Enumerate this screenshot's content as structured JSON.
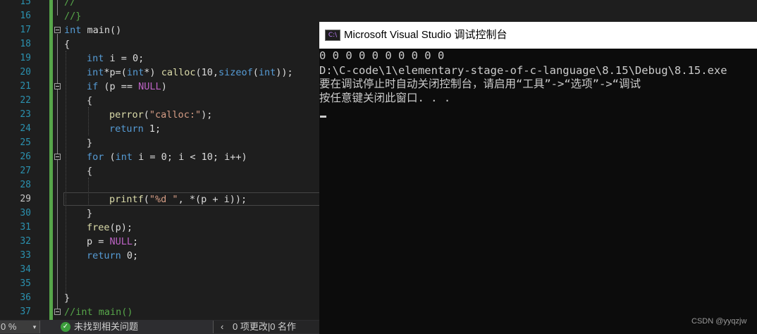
{
  "editor": {
    "line_numbers": [
      "15",
      "16",
      "17",
      "18",
      "19",
      "20",
      "21",
      "22",
      "23",
      "24",
      "25",
      "26",
      "27",
      "28",
      "29",
      "30",
      "31",
      "32",
      "33",
      "34",
      "35",
      "36",
      "37"
    ],
    "code": {
      "l15": "//",
      "l16": "//}",
      "l17_kw": "int",
      "l17_rest": " main()",
      "l18": "{",
      "l19_kw": "int",
      "l19_rest": " i = 0;",
      "l20_kw1": "int",
      "l20_a": "*p=(",
      "l20_kw2": "int",
      "l20_b": "*) ",
      "l20_fn": "calloc",
      "l20_c": "(10,",
      "l20_kw3": "sizeof",
      "l20_d": "(",
      "l20_kw4": "int",
      "l20_e": "));",
      "l21_kw": "if",
      "l21_a": " (p == ",
      "l21_mac": "NULL",
      "l21_b": ")",
      "l22": "{",
      "l23_fn": "perror",
      "l23_a": "(",
      "l23_str": "\"calloc:\"",
      "l23_b": ");",
      "l24_kw": "return",
      "l24_rest": " 1;",
      "l25": "}",
      "l26_kw": "for",
      "l26_a": " (",
      "l26_kw2": "int",
      "l26_b": " i = 0; i < 10; i++)",
      "l27": "{",
      "l29_fn": "printf",
      "l29_a": "(",
      "l29_str": "\"%d \"",
      "l29_b": ", *(p + i));",
      "l30": "}",
      "l31_fn": "free",
      "l31_rest": "(p);",
      "l32_a": "p = ",
      "l32_mac": "NULL",
      "l32_b": ";",
      "l33_kw": "return",
      "l33_rest": " 0;",
      "l36": "}",
      "l37": "//int main()"
    }
  },
  "statusbar": {
    "zoom": "0 %",
    "zoom_arrow": "▾",
    "issues_icon": "check-circle-icon",
    "issues_text": "未找到相关问题",
    "changes_arrow": "‹",
    "changes_text": "0 项更改|0 名作"
  },
  "console": {
    "icon_label": "C:\\",
    "title": "Microsoft Visual Studio 调试控制台",
    "lines": [
      "0 0 0 0 0 0 0 0 0 0",
      "D:\\C-code\\1\\elementary-stage-of-c-language\\8.15\\Debug\\8.15.exe",
      "要在调试停止时自动关闭控制台，请启用“工具”->“选项”->“调试",
      "按任意键关闭此窗口. . ."
    ],
    "watermark": "CSDN @yyqzjw"
  },
  "colors": {
    "editor_bg": "#1e1e1e",
    "line_number": "#2b91af",
    "keyword": "#569cd6",
    "string": "#d69d85",
    "macro": "#bd63c5",
    "change_marker": "#57a64a",
    "console_bg": "#0c0c0c"
  }
}
